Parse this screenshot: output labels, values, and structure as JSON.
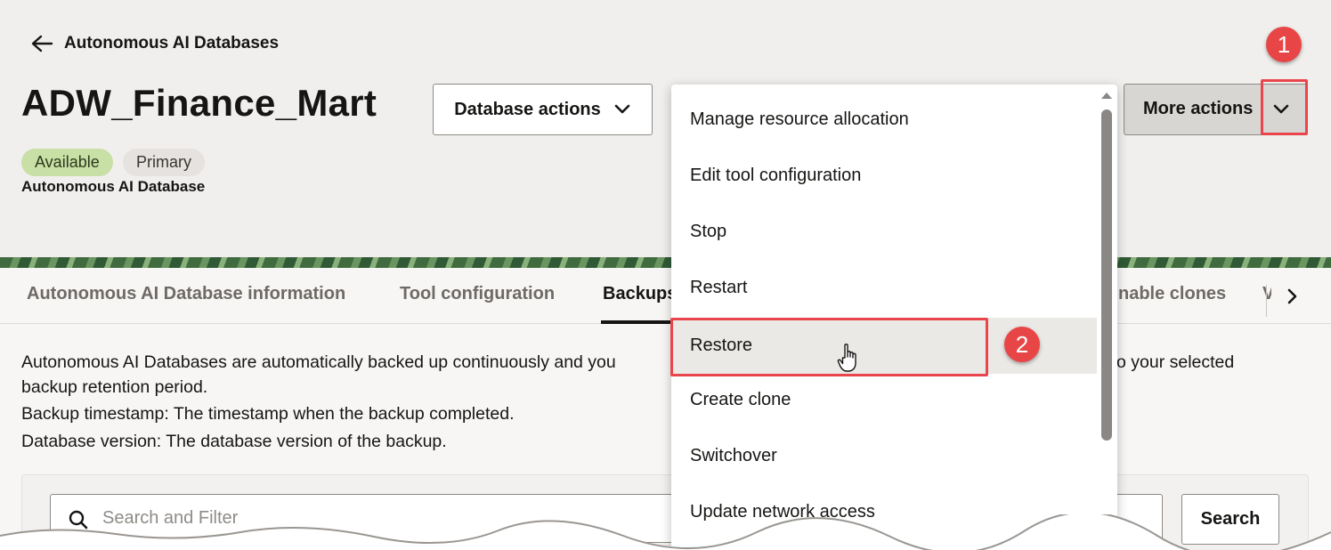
{
  "breadcrumb": {
    "back_label": "Autonomous AI Databases"
  },
  "header": {
    "title": "ADW_Finance_Mart",
    "badges": {
      "status": "Available",
      "role": "Primary"
    },
    "subtitle": "Autonomous AI Database",
    "database_actions_label": "Database actions",
    "more_actions_label": "More actions"
  },
  "tabs": [
    {
      "label": "Autonomous AI Database information"
    },
    {
      "label": "Tool configuration"
    },
    {
      "label": "Backups"
    },
    {
      "label": "nable clones"
    },
    {
      "label": "V"
    }
  ],
  "description": {
    "line1_left": "Autonomous AI Databases are automatically backed up continuously and you",
    "line1_right": "o your selected",
    "line2": "backup retention period.",
    "line3": "Backup timestamp: The timestamp when the backup completed.",
    "line4": "Database version: The database version of the backup."
  },
  "search": {
    "placeholder": "Search and Filter",
    "button_label": "Search"
  },
  "menu": {
    "items": [
      {
        "label": "Manage resource allocation"
      },
      {
        "label": "Edit tool configuration"
      },
      {
        "label": "Stop"
      },
      {
        "label": "Restart"
      },
      {
        "label": "Restore"
      },
      {
        "label": "Create clone"
      },
      {
        "label": "Switchover"
      },
      {
        "label": "Update network access"
      }
    ],
    "hovered_item": "Restore"
  },
  "callouts": {
    "first": "1",
    "second": "2"
  },
  "colors": {
    "callout": "#e84646",
    "highlight_border": "#e8464c",
    "badge_available_bg": "#c8dfa5",
    "badge_primary_bg": "#e5e2df",
    "header_bg": "#f1efed"
  },
  "icons": [
    "back-arrow-icon",
    "chevron-down-icon",
    "chevron-right-icon",
    "search-icon",
    "scroll-up-arrow-icon",
    "hand-pointer-icon"
  ]
}
